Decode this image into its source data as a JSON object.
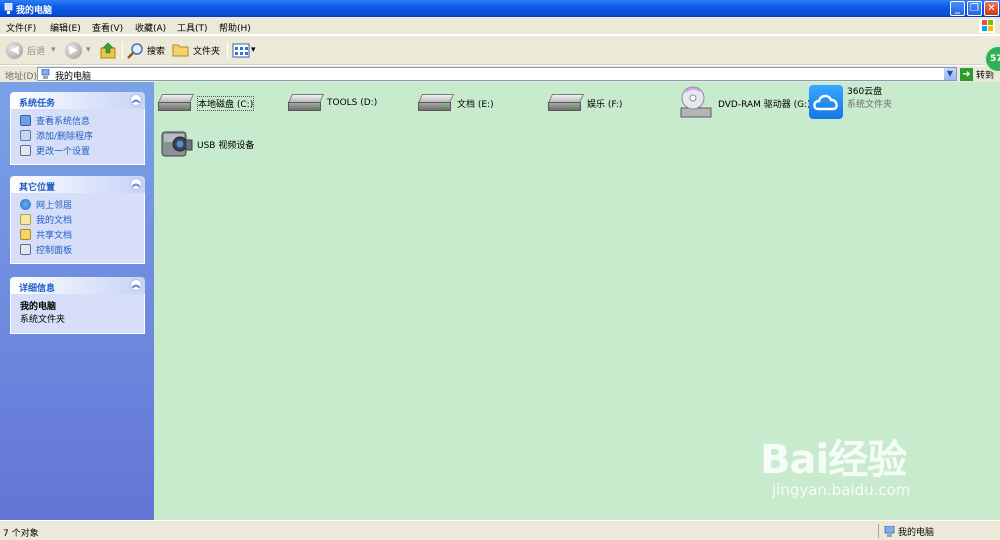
{
  "window": {
    "title": "我的电脑"
  },
  "menu": [
    "文件(F)",
    "编辑(E)",
    "查看(V)",
    "收藏(A)",
    "工具(T)",
    "帮助(H)"
  ],
  "toolbar": {
    "back": "后退",
    "search": "搜索",
    "folders": "文件夹"
  },
  "address": {
    "label": "地址(D)",
    "value": "我的电脑",
    "go": "转到",
    "badge": "57"
  },
  "sidebar": {
    "system_tasks": {
      "title": "系统任务",
      "links": [
        "查看系统信息",
        "添加/删除程序",
        "更改一个设置"
      ]
    },
    "other_places": {
      "title": "其它位置",
      "links": [
        "网上邻居",
        "我的文档",
        "共享文档",
        "控制面板"
      ]
    },
    "details": {
      "title": "详细信息",
      "name": "我的电脑",
      "type": "系统文件夹"
    }
  },
  "items": [
    {
      "label": "本地磁盘 (C:)"
    },
    {
      "label": "TOOLS (D:)"
    },
    {
      "label": "文档 (E:)"
    },
    {
      "label": "娱乐 (F:)"
    },
    {
      "label": "DVD-RAM 驱动器 (G:)"
    },
    {
      "label": "360云盘",
      "sublabel": "系统文件夹"
    },
    {
      "label": "USB 视频设备"
    }
  ],
  "status": {
    "left": "7 个对象",
    "right": "我的电脑"
  },
  "watermark": {
    "logo": "Bai经验",
    "url": "jingyan.baidu.com"
  },
  "colors": {
    "title_bar": "#0c5ae8",
    "sidebar": "#6f8ee0",
    "content_bg": "#c7ebcc",
    "link": "#215dc6"
  }
}
